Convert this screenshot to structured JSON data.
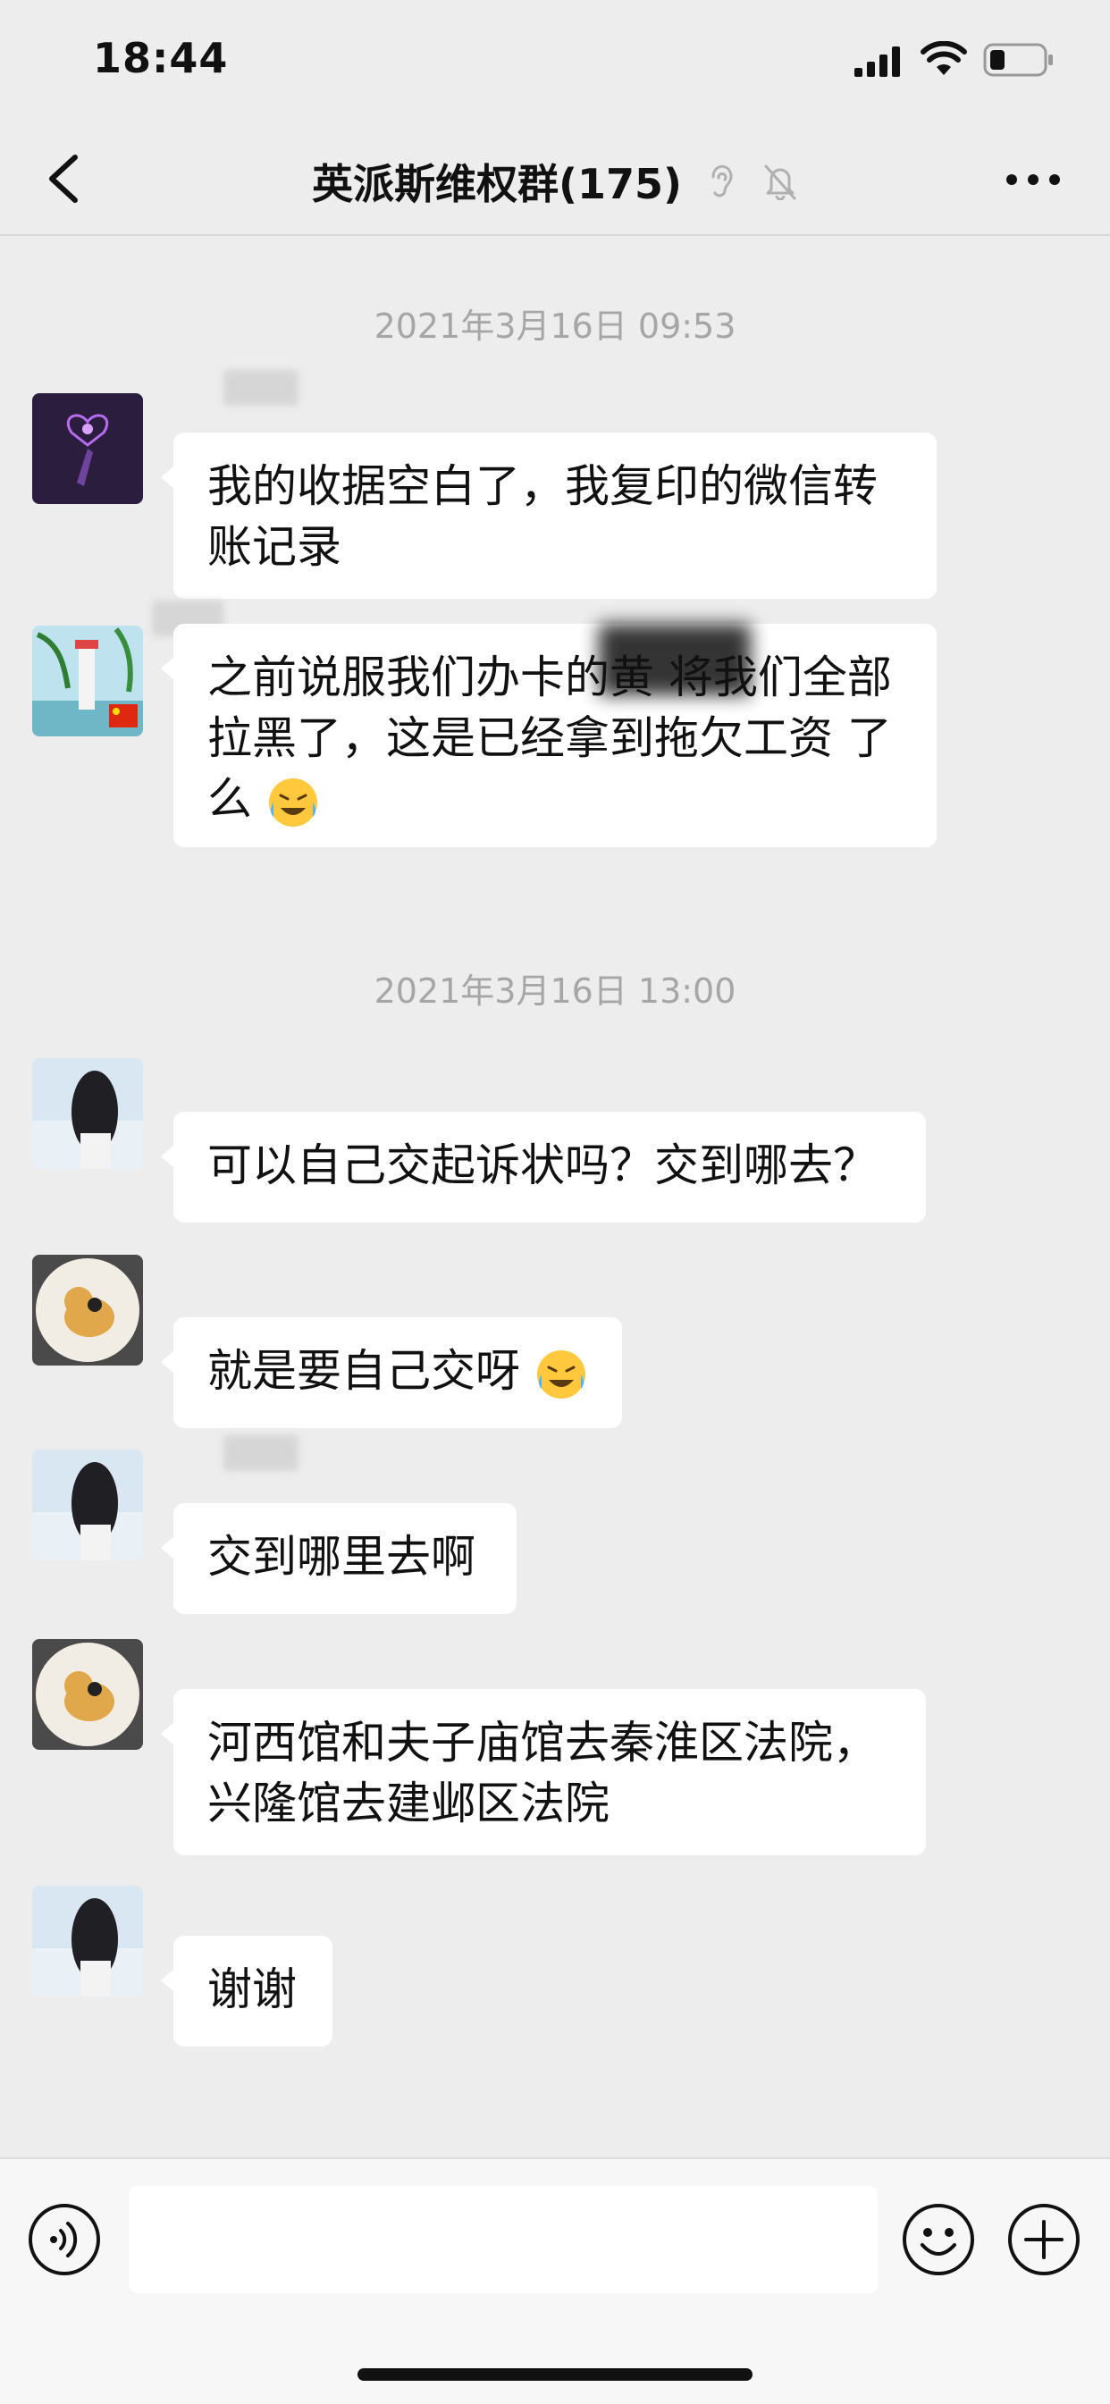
{
  "status_bar": {
    "time": "18:44"
  },
  "header": {
    "title": "英派斯维权群(175)"
  },
  "chat": {
    "timestamps": [
      "2021年3月16日 09:53",
      "2021年3月16日 13:00"
    ],
    "messages": [
      {
        "text": "我的收据空白了，我复印的微信转账记录",
        "emoji": false
      },
      {
        "text": "之前说服我们办卡的黄 将我们全部拉黑了，这是已经拿到拖欠工资 了么",
        "emoji": true
      },
      {
        "text": "可以自己交起诉状吗？交到哪去？",
        "emoji": false
      },
      {
        "text": "就是要自己交呀",
        "emoji": true
      },
      {
        "text": "交到哪里去啊",
        "emoji": false
      },
      {
        "text": "河西馆和夫子庙馆去秦淮区法院，兴隆馆去建邺区法院",
        "emoji": false
      },
      {
        "text": "谢谢",
        "emoji": false
      }
    ]
  },
  "input": {
    "value": ""
  },
  "colors": {
    "background": "#ededed",
    "bubble": "#ffffff",
    "timestamp": "#a6a6a6"
  }
}
